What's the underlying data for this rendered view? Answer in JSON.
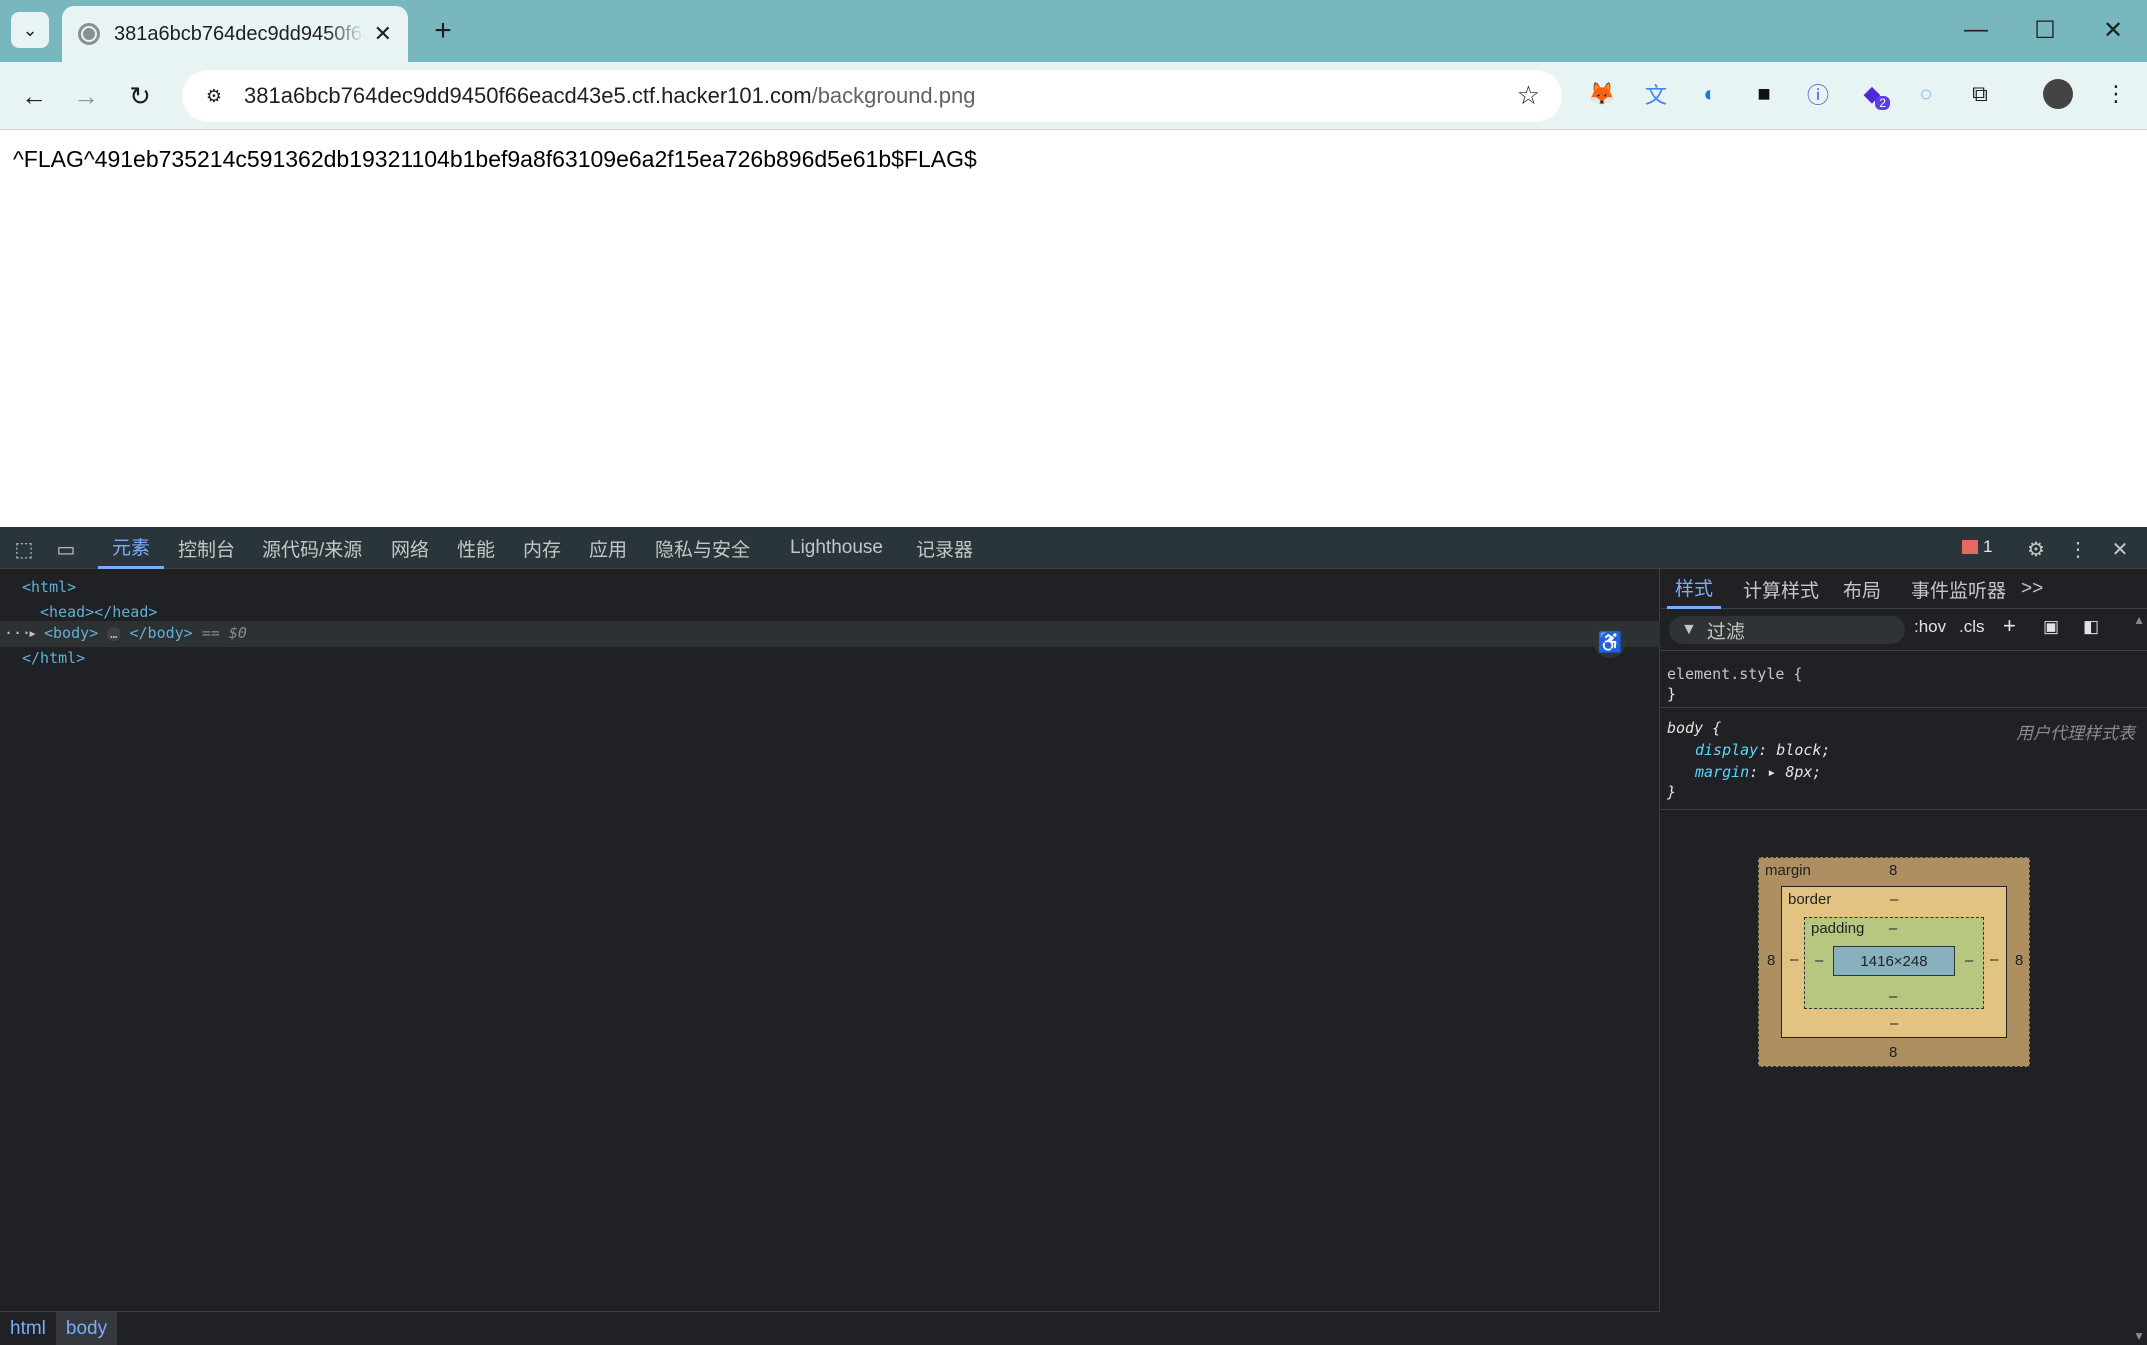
{
  "browser": {
    "tab_title": "381a6bcb764dec9dd9450f66eacd43e5.ctf.hacker101.com/background.png",
    "url_host": "381a6bcb764dec9dd9450f66eacd43e5.ctf.hacker101.com",
    "url_path": "/background.png",
    "icons": {
      "tab_search": "chevron-down-icon",
      "close_tab": "close-icon",
      "new_tab": "plus-icon",
      "back": "arrow-left-icon",
      "forward": "arrow-right-icon",
      "reload": "reload-icon",
      "bookmark": "star-icon"
    },
    "extension_badge": "2"
  },
  "page": {
    "body_text": "^FLAG^491eb735214c591362db19321104b1bef9a8f63109e6a2f15ea726b896d5e61b$FLAG$"
  },
  "devtools": {
    "tabs": [
      "元素",
      "控制台",
      "源代码/来源",
      "网络",
      "性能",
      "内存",
      "应用",
      "隐私与安全",
      "Lighthouse",
      "记录器"
    ],
    "active_tab": "元素",
    "issues_count": "1",
    "dom": {
      "html_open": "<html>",
      "head": "<head></head>",
      "body_open": "<body>",
      "body_close": "</body>",
      "selected_marker": "== $0",
      "html_close": "</html>"
    },
    "breadcrumbs": [
      "html",
      "body"
    ],
    "styles": {
      "tabs": [
        "样式",
        "计算样式",
        "布局",
        "事件监听器"
      ],
      "more_tabs": ">>",
      "filter_placeholder": "过滤",
      "hov": ":hov",
      "cls": ".cls",
      "element_style_open": "element.style {",
      "element_style_close": "}",
      "body_selector": "body {",
      "user_agent_label": "用户代理样式表",
      "rules": [
        {
          "prop": "display",
          "value": "block;"
        },
        {
          "prop": "margin",
          "value": "8px;"
        }
      ],
      "body_close": "}"
    },
    "box_model": {
      "margin_label": "margin",
      "margin_top": "8",
      "margin_bottom": "8",
      "margin_left": "8",
      "margin_right": "8",
      "border_label": "border",
      "border_value": "–",
      "padding_label": "padding",
      "padding_value": "–",
      "content_size": "1416×248"
    }
  }
}
